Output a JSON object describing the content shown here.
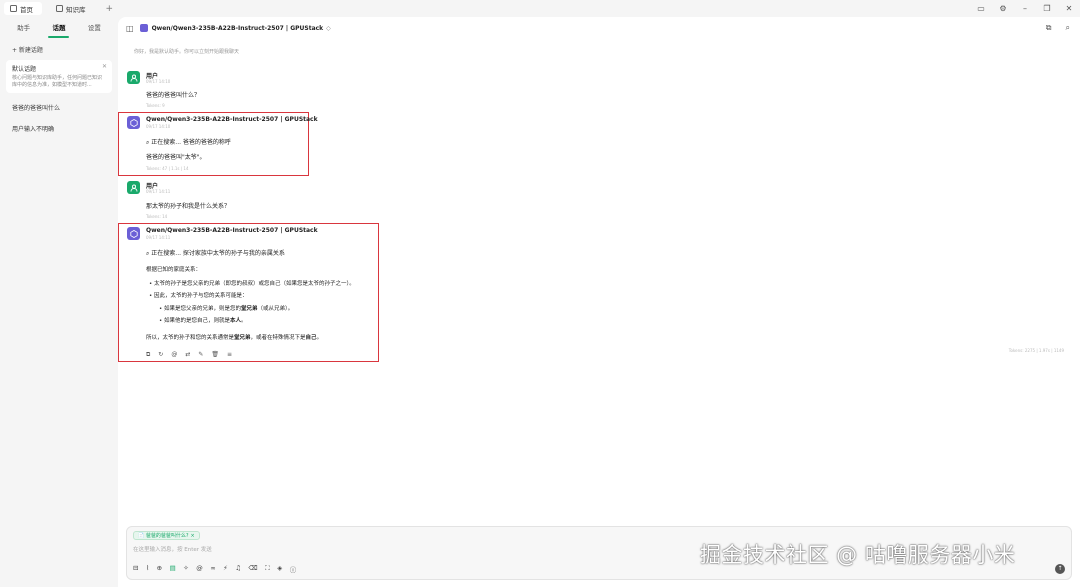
{
  "window": {
    "tabs": [
      {
        "label": "首页"
      },
      {
        "label": "知识库"
      }
    ],
    "controls": [
      "monitor-icon",
      "gear-icon",
      "minimize-icon",
      "restore-icon",
      "close-icon"
    ]
  },
  "sidebar": {
    "tabs": [
      {
        "label": "助手"
      },
      {
        "label": "话题"
      },
      {
        "label": "设置"
      }
    ],
    "new_topic": "+ 新建话题",
    "topics": [
      {
        "title": "默认话题",
        "desc": "核心问题与知识库助手，任何问题已知识库中的信息为准，如模型不知道时..."
      },
      {
        "title": "爸爸的爸爸叫什么",
        "desc": ""
      },
      {
        "title": "用户输入不明确",
        "desc": ""
      }
    ]
  },
  "header": {
    "model_name": "Qwen/Qwen3-235B-A22B-Instruct-2507 | GPUStack",
    "chevron": "◇"
  },
  "prompt_hint": "你好，我是默认助手。你可以立刻开始跟我聊天",
  "messages": [
    {
      "role": "用户",
      "time": "09/17 14:10",
      "text": "爸爸的爸爸叫什么？",
      "meta": "Tokens: 9"
    },
    {
      "role": "Qwen/Qwen3-235B-A22B-Instruct-2507 | GPUStack",
      "time": "09/17 14:10",
      "search": "正在搜索... 爸爸的爸爸的称呼",
      "text": "爸爸的爸爸叫\"太爷\"。",
      "meta": "Tokens: 47 | 1.1s | 14"
    },
    {
      "role": "用户",
      "time": "09/17 14:11",
      "text": "那太爷的孙子和我是什么关系？",
      "meta": "Tokens: 14"
    },
    {
      "role": "Qwen/Qwen3-235B-A22B-Instruct-2507 | GPUStack",
      "time": "09/17 14:11",
      "search": "正在搜索... 探讨家族中太爷的孙子与我的亲属关系",
      "intro": "根据已知的家庭关系：",
      "b1": "太爷的孙子是您父亲的兄弟（即您的叔叔）或您自己（如果您是太爷的孙子之一）。",
      "b2": "因此，太爷的孙子与您的关系可能是：",
      "b3_pre": "如果是您父亲的兄弟，则是您的",
      "b3_bold": "堂兄弟",
      "b3_post": "（或从兄弟）。",
      "b4_pre": "如果他的是您自己，则就是",
      "b4_bold": "本人",
      "b4_post": "。",
      "concl_pre": "所以，太爷的孙子和您的关系通常是",
      "concl_b1": "堂兄弟",
      "concl_mid": "，或者在特殊情况下是",
      "concl_b2": "自己",
      "concl_post": "。",
      "meta": "Tokens: 2275 | 1.97s | 1149"
    }
  ],
  "input": {
    "chip": "📄 爸爸的爸爸叫什么?",
    "placeholder": "在这里输入消息，按 Enter 发送"
  },
  "watermark": "掘金技术社区 @ 咕噜服务器小米",
  "colors": {
    "accent": "#1aa96b",
    "bot": "#6b5fd6",
    "highlight": "#d9363e"
  }
}
